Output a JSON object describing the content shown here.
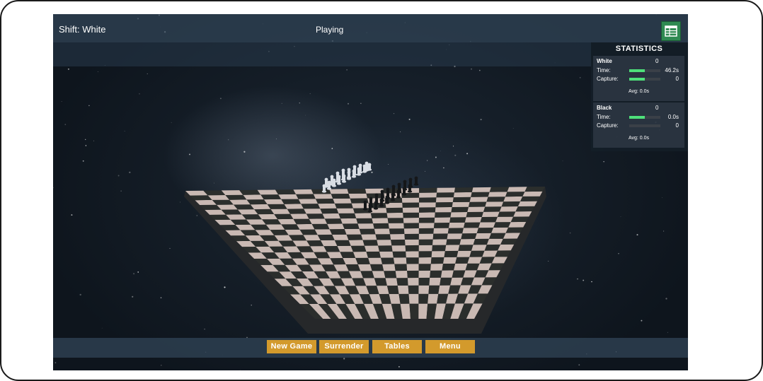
{
  "hud": {
    "shift": "Shift: White",
    "status": "Playing"
  },
  "toolbar": {
    "tables_icon": "table-grid-icon"
  },
  "statistics": {
    "title": "STATISTICS",
    "white": {
      "name": "White",
      "score": "0",
      "time_label": "Time:",
      "time_value": "46.2s",
      "time_fill": 0.5,
      "capture_label": "Capture:",
      "capture_value": "0",
      "capture_fill": 0.5,
      "avg": "Avg: 0.0s"
    },
    "black": {
      "name": "Black",
      "score": "0",
      "time_label": "Time:",
      "time_value": "0.0s",
      "time_fill": 0.5,
      "capture_label": "Capture:",
      "capture_value": "0",
      "capture_fill": 0.0,
      "avg": "Avg: 0.0s"
    }
  },
  "buttons": {
    "new_game": "New Game",
    "surrender": "Surrender",
    "tables": "Tables",
    "menu": "Menu"
  },
  "colors": {
    "accent_button": "#d39a2c",
    "bar_fill": "#4ee07a",
    "light_square": "#c9b9b3",
    "dark_square": "#2b2e2c"
  }
}
